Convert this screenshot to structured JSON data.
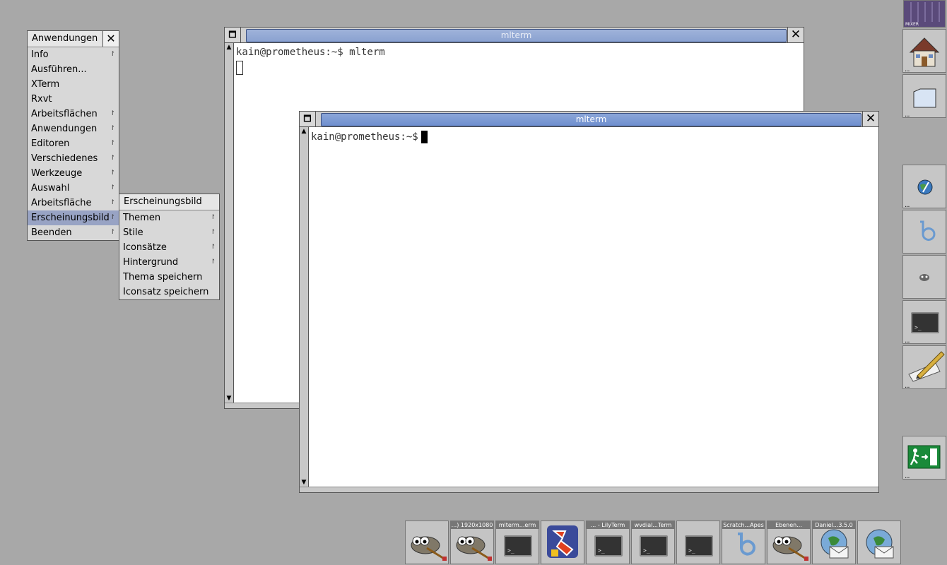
{
  "main_menu": {
    "title": "Anwendungen",
    "items": [
      {
        "label": "Info",
        "submenu": true
      },
      {
        "label": "Ausführen...",
        "submenu": false
      },
      {
        "label": "XTerm",
        "submenu": false
      },
      {
        "label": "Rxvt",
        "submenu": false
      },
      {
        "label": "Arbeitsflächen",
        "submenu": true
      },
      {
        "label": "Anwendungen",
        "submenu": true
      },
      {
        "label": "Editoren",
        "submenu": true
      },
      {
        "label": "Verschiedenes",
        "submenu": true
      },
      {
        "label": "Werkzeuge",
        "submenu": true
      },
      {
        "label": "Auswahl",
        "submenu": true
      },
      {
        "label": "Arbeitsfläche",
        "submenu": true
      },
      {
        "label": "Erscheinungsbild",
        "submenu": true,
        "active": true
      },
      {
        "label": "Beenden",
        "submenu": true
      }
    ]
  },
  "sub_menu": {
    "title": "Erscheinungsbild",
    "items": [
      {
        "label": "Themen",
        "submenu": true
      },
      {
        "label": "Stile",
        "submenu": true
      },
      {
        "label": "Iconsätze",
        "submenu": true
      },
      {
        "label": "Hintergrund",
        "submenu": true
      },
      {
        "label": "Thema speichern",
        "submenu": false
      },
      {
        "label": "Iconsatz speichern",
        "submenu": false
      }
    ]
  },
  "window_back": {
    "title": "mlterm",
    "line1": "kain@prometheus:~$ mlterm"
  },
  "window_front": {
    "title": "mlterm",
    "prompt": "kain@prometheus:~$"
  },
  "submenu_marker": "↾",
  "dots": "...",
  "close_glyph": "✕",
  "dock": {
    "top_label": "MIXER",
    "icons": [
      "mixer-icon",
      "home-icon",
      "folder-icon",
      "web-browser-icon",
      "blender-icon",
      "gimp-cat-icon",
      "terminal-icon",
      "text-editor-icon",
      "exit-icon"
    ]
  },
  "taskbar": {
    "items": [
      {
        "label": "",
        "icon": "gimp-icon"
      },
      {
        "label": "...) 1920x1080",
        "icon": "gimp-icon"
      },
      {
        "label": "mlterm...erm",
        "icon": "terminal-icon"
      },
      {
        "label": "",
        "icon": "app-icon"
      },
      {
        "label": "... - LilyTerm",
        "icon": "terminal-icon"
      },
      {
        "label": "wvdial...Term",
        "icon": "terminal-icon"
      },
      {
        "label": "",
        "icon": "terminal-icon"
      },
      {
        "label": "Scratch...Apes",
        "icon": "blender-icon"
      },
      {
        "label": "Ebenen...",
        "icon": "gimp-icon"
      },
      {
        "label": "Daniel...3.5.0",
        "icon": "mail-icon"
      },
      {
        "label": "",
        "icon": "mail-icon"
      }
    ]
  }
}
